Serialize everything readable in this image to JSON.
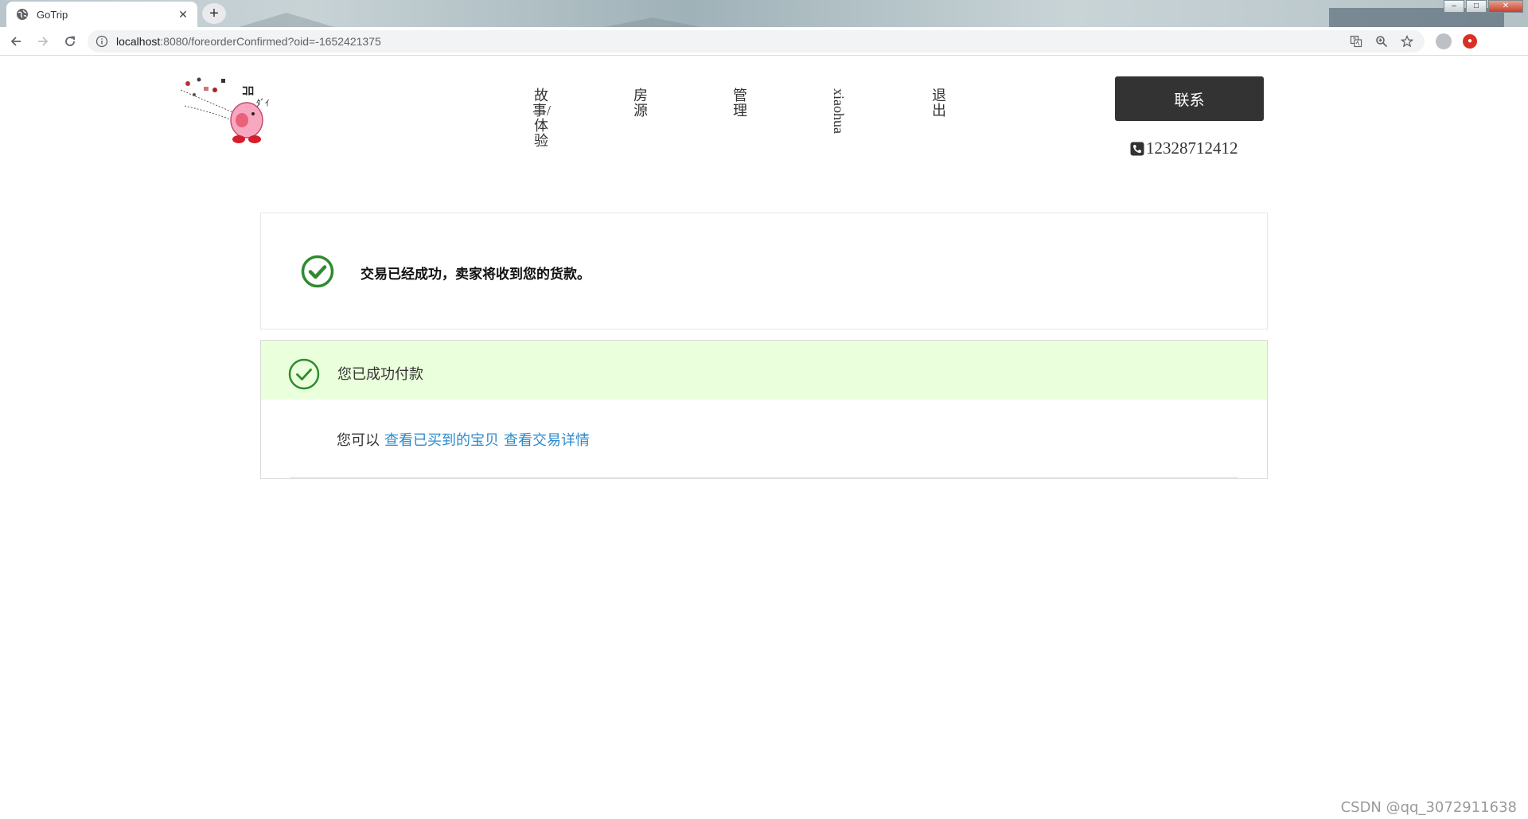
{
  "browser": {
    "tab_title": "GoTrip",
    "tab_close": "✕",
    "new_tab": "+",
    "url_host": "localhost",
    "url_path": ":8080/foreorderConfirmed?oid=-1652421375",
    "window_buttons": [
      "–",
      "□",
      "✕"
    ]
  },
  "header": {
    "nav": [
      {
        "label": "故事/体验"
      },
      {
        "label": "房源"
      },
      {
        "label": "管理"
      },
      {
        "label": "xiaohua"
      },
      {
        "label": "退出"
      }
    ],
    "contact_label": "联系",
    "phone": "12328712412"
  },
  "confirm": {
    "message": "交易已经成功，卖家将收到您的货款。"
  },
  "payment": {
    "title": "您已成功付款",
    "prefix": "您可以",
    "link1": "查看已买到的宝贝",
    "link2": "查看交易详情"
  },
  "watermark": "CSDN @qq_3072911638",
  "colors": {
    "accent_link": "#2b8bcd",
    "success_green": "#2e8b2e",
    "success_bg": "#eaffdb",
    "dark_button": "#333333"
  },
  "icons": {
    "favicon": "globe-icon",
    "confirm": "check-circle-icon",
    "payment": "check-circle-outline-icon",
    "phone": "phone-icon"
  }
}
